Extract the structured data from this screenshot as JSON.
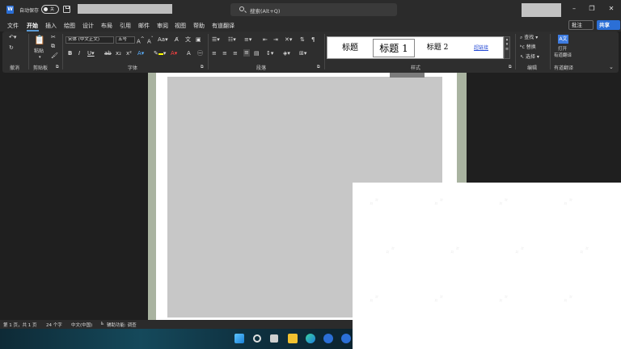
{
  "titlebar": {
    "autosave_label": "自动保存",
    "autosave_state": "关",
    "search_placeholder": "搜索(Alt+Q)",
    "minimize": "–",
    "restore": "❐",
    "close": "✕",
    "logo_letter": "W"
  },
  "tabs": [
    {
      "label": "文件",
      "active": false
    },
    {
      "label": "开始",
      "active": true
    },
    {
      "label": "插入",
      "active": false
    },
    {
      "label": "绘图",
      "active": false
    },
    {
      "label": "设计",
      "active": false
    },
    {
      "label": "布局",
      "active": false
    },
    {
      "label": "引用",
      "active": false
    },
    {
      "label": "邮件",
      "active": false
    },
    {
      "label": "审阅",
      "active": false
    },
    {
      "label": "视图",
      "active": false
    },
    {
      "label": "帮助",
      "active": false
    },
    {
      "label": "有道翻译",
      "active": false
    }
  ],
  "actions": {
    "comment": "批注",
    "share": "共享"
  },
  "ribbon": {
    "undo_group": "撤消",
    "clipboard_group": "剪贴板",
    "paste_label": "粘贴",
    "font_group": "字体",
    "font_name": "宋体 (中文正文)",
    "font_size": "五号",
    "paragraph_group": "段落",
    "styles_group": "样式",
    "styles": [
      "标题",
      "标题 1",
      "标题 2",
      "超链接"
    ],
    "editing_group": "编辑",
    "find_label": "查找",
    "replace_label": "替换",
    "select_label": "选择",
    "youdao_group": "有道翻译",
    "youdao_open": "打开",
    "youdao_name": "有道翻译"
  },
  "status": {
    "page": "第 1 页，共 1 页",
    "words": "24 个字",
    "language": "中文(中国)",
    "accessibility": "辅助功能: 调查"
  },
  "colors": {
    "accent": "#2b6fd6",
    "highlight": "#ffff00",
    "font_color": "#ff0000"
  }
}
